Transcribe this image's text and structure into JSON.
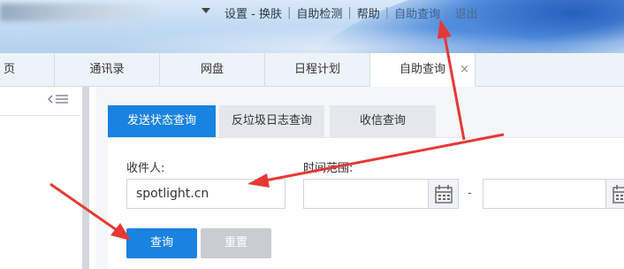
{
  "header": {
    "topnav": [
      {
        "label": "设置 - 换肤"
      },
      {
        "label": "自助检测"
      },
      {
        "label": "帮助"
      },
      {
        "label": "自助查询"
      },
      {
        "label": "退出"
      }
    ],
    "separator": "|"
  },
  "tabs": [
    {
      "label": "页"
    },
    {
      "label": "通讯录"
    },
    {
      "label": "网盘"
    },
    {
      "label": "日程计划"
    },
    {
      "label": "自助查询",
      "close": "×"
    }
  ],
  "sidebar": {
    "collapse_icon": "collapse-menu-icon"
  },
  "query": {
    "subtabs": [
      {
        "label": "发送状态查询"
      },
      {
        "label": "反垃圾日志查询"
      },
      {
        "label": "收信查询"
      }
    ],
    "recipient_label": "收件人:",
    "recipient_value": "spotlight.cn",
    "time_range_label": "时间范围:",
    "range_dash": "-",
    "search_button": "查询",
    "reset_button": "重置"
  },
  "colors": {
    "accent": "#1a82e0",
    "annotation": "#e53935"
  }
}
